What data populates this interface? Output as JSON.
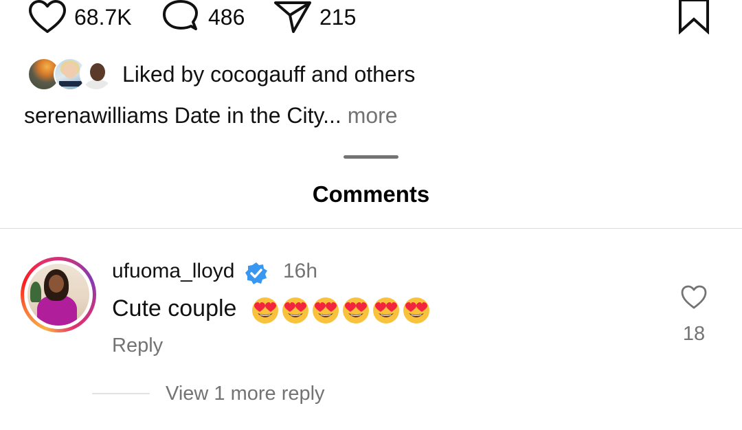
{
  "post_actions": {
    "likes_count": "68.7K",
    "comments_count": "486",
    "shares_count": "215",
    "icons": [
      "heart-icon",
      "comment-bubble-icon",
      "paper-plane-icon",
      "bookmark-icon"
    ]
  },
  "liked_by": {
    "text": "Liked by cocogauff and others"
  },
  "caption": {
    "text": "serenawilliams Date in the City...",
    "more_label": " more"
  },
  "comments_sheet": {
    "title": "Comments"
  },
  "comment": {
    "username": "ufuoma_lloyd",
    "verified": true,
    "time": "16h",
    "text": "Cute couple",
    "emoji_name": "smiling-face-with-heart-eyes",
    "emoji_count": 6,
    "reply_label": "Reply",
    "like_count": "18",
    "view_replies_label": "View 1 more reply"
  },
  "colors": {
    "text_primary": "#111111",
    "text_secondary": "#737373",
    "verified_blue": "#3897f0",
    "divider": "#dbdbdb"
  }
}
